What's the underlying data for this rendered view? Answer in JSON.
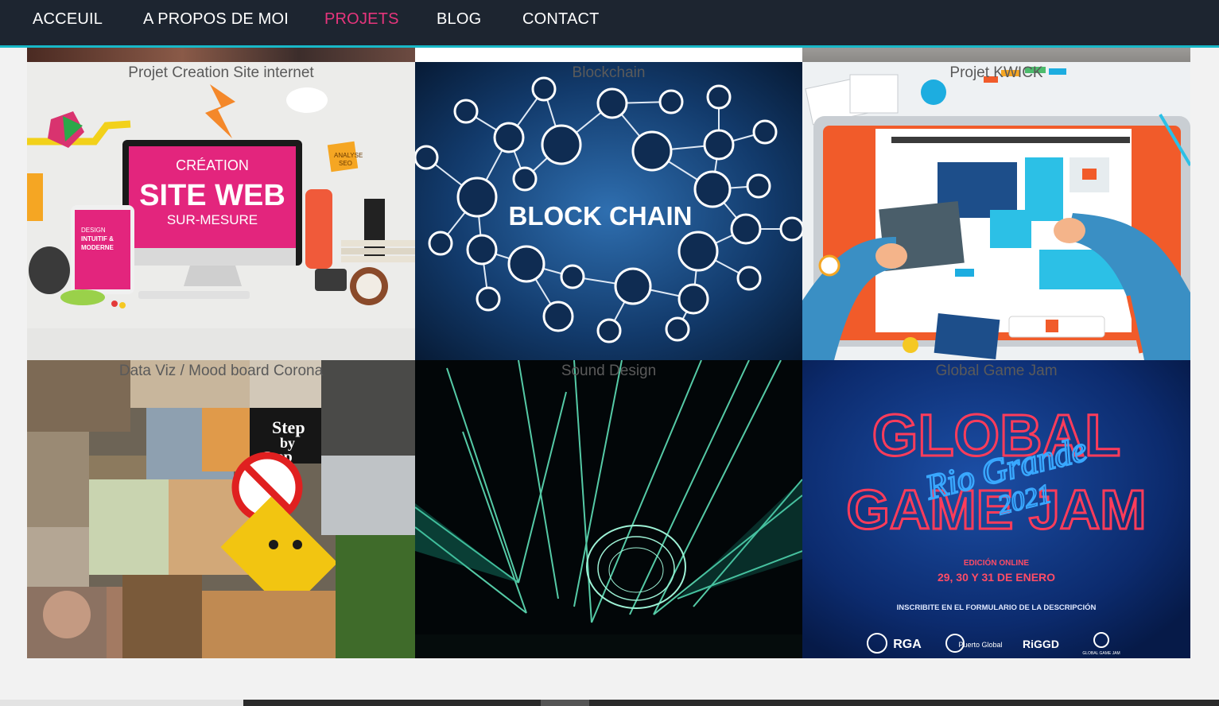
{
  "nav": {
    "items": [
      {
        "label": "ACCEUIL"
      },
      {
        "label": "A PROPOS DE MOI"
      },
      {
        "label": "PROJETS"
      },
      {
        "label": "BLOG"
      },
      {
        "label": "CONTACT"
      }
    ],
    "active_index": 2
  },
  "projects": [
    {
      "caption": "Projet Creation Site internet",
      "image_text": {
        "line1": "CRÉATION",
        "line2": "SITE WEB",
        "line3": "SUR-MESURE",
        "tablet1": "DESIGN",
        "tablet2": "INTUITIF &",
        "tablet3": "MODERNE",
        "note1": "ANALYSE",
        "note2": "SEO"
      }
    },
    {
      "caption": "Blockchain",
      "image_text": {
        "title": "BLOCK CHAIN"
      }
    },
    {
      "caption": "Projet KWICK"
    },
    {
      "caption": "Data Viz / Mood board Corona",
      "image_text": {
        "sign1": "Step",
        "sign2": "by",
        "sign3": "Step"
      }
    },
    {
      "caption": "Sound Design"
    },
    {
      "caption": "Global Game Jam",
      "image_text": {
        "l1": "GLOBAL",
        "l2": "GAME JAM",
        "script": "Rio Grande",
        "year": "2021",
        "edition": "EDICIÓN ONLINE",
        "dates": "29, 30 Y 31 DE ENERO",
        "cta": "INSCRIBITE EN EL FORMULARIO DE LA DESCRIPCIÓN",
        "logo1": "RGA",
        "logo2": "Puerto Global",
        "logo3": "RiGGD",
        "logo4": "GLOBAL GAME JAM"
      }
    }
  ],
  "colors": {
    "nav_bg": "#1d2530",
    "accent": "#e6357c",
    "nav_border": "#18b8c7"
  }
}
